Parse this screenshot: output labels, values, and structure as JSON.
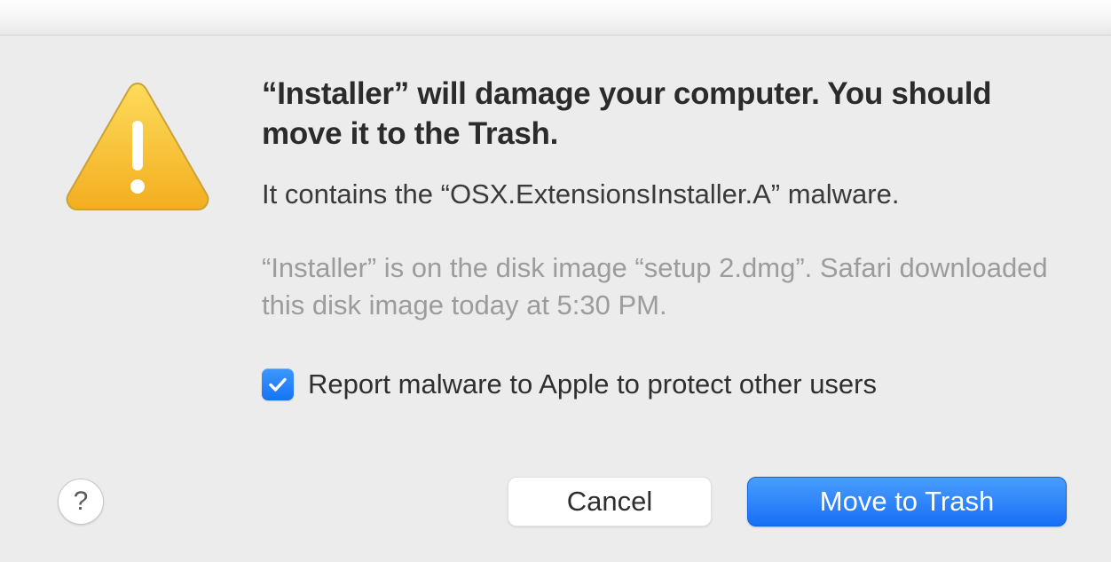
{
  "dialog": {
    "title": "“Installer” will damage your computer. You should move it to the Trash.",
    "subtitle": "It contains the “OSX.ExtensionsInstaller.A” malware.",
    "detail": "“Installer” is on the disk image “setup 2.dmg”. Safari downloaded this disk image today at 5:30 PM.",
    "checkbox_label": "Report malware to Apple to protect other users",
    "checkbox_checked": true,
    "help_label": "?",
    "cancel_label": "Cancel",
    "primary_label": "Move to Trash"
  },
  "icons": {
    "warning": "warning-triangle-icon",
    "checkmark": "checkmark-icon"
  },
  "colors": {
    "accent": "#1b78f7",
    "warning_fill": "#f7c23c",
    "warning_stroke": "#d19a1a"
  }
}
